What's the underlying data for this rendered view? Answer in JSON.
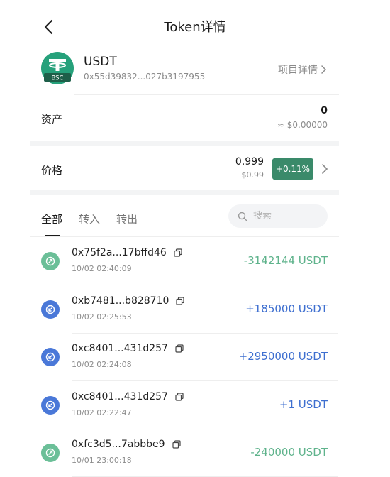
{
  "header": {
    "title": "Token详情"
  },
  "token": {
    "symbol": "USDT",
    "address": "0x55d39832...027b3197955",
    "logo_badge": "BSC",
    "project_link": "项目详情"
  },
  "asset": {
    "label": "资产",
    "amount": "0",
    "usd": "≈ $0.00000"
  },
  "price": {
    "label": "价格",
    "value": "0.999",
    "usd": "$0.99",
    "change": "+0.11%"
  },
  "tabs": [
    {
      "label": "全部",
      "active": true
    },
    {
      "label": "转入",
      "active": false
    },
    {
      "label": "转出",
      "active": false
    }
  ],
  "search": {
    "placeholder": "搜索"
  },
  "transactions": [
    {
      "hash": "0x75f2a...17bffd46",
      "time": "10/02 02:40:09",
      "amount": "-3142144 USDT",
      "direction": "out"
    },
    {
      "hash": "0xb7481...b828710",
      "time": "10/02 02:25:53",
      "amount": "+185000 USDT",
      "direction": "in"
    },
    {
      "hash": "0xc8401...431d257",
      "time": "10/02 02:24:08",
      "amount": "+2950000 USDT",
      "direction": "in"
    },
    {
      "hash": "0xc8401...431d257",
      "time": "10/02 02:22:47",
      "amount": "+1 USDT",
      "direction": "in"
    },
    {
      "hash": "0xfc3d5...7abbbe9",
      "time": "10/01 23:00:18",
      "amount": "-240000 USDT",
      "direction": "out"
    }
  ],
  "colors": {
    "tether_green": "#26a17b",
    "in": "#3e6fd0",
    "out": "#5fb38c",
    "change_badge": "#3a8a6a"
  },
  "icons": {
    "back": "chevron-left-icon",
    "copy": "copy-icon",
    "search": "search-icon",
    "out": "arrow-out-icon",
    "in": "arrow-in-icon"
  }
}
